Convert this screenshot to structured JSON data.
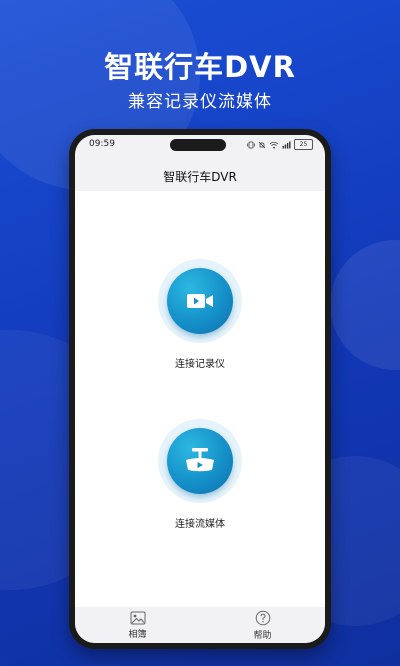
{
  "promo": {
    "headline": "智联行车DVR",
    "subline": "兼容记录仪流媒体"
  },
  "status_bar": {
    "time": "09:59",
    "icons": [
      "vibrate-icon",
      "mute-icon",
      "wifi-icon",
      "signal-icon",
      "battery-icon"
    ],
    "battery_level": "25"
  },
  "nav": {
    "title": "智联行车DVR"
  },
  "actions": [
    {
      "label": "连接记录仪",
      "icon": "video-camera-icon"
    },
    {
      "label": "连接流媒体",
      "icon": "rearview-mirror-icon"
    }
  ],
  "tabbar": {
    "items": [
      {
        "label": "相簿",
        "icon": "photo-album-icon"
      },
      {
        "label": "帮助",
        "icon": "help-icon"
      }
    ]
  },
  "colors": {
    "background": "#1a4fd6",
    "accent": "#1590c8",
    "halo": "#e6f3fa"
  }
}
